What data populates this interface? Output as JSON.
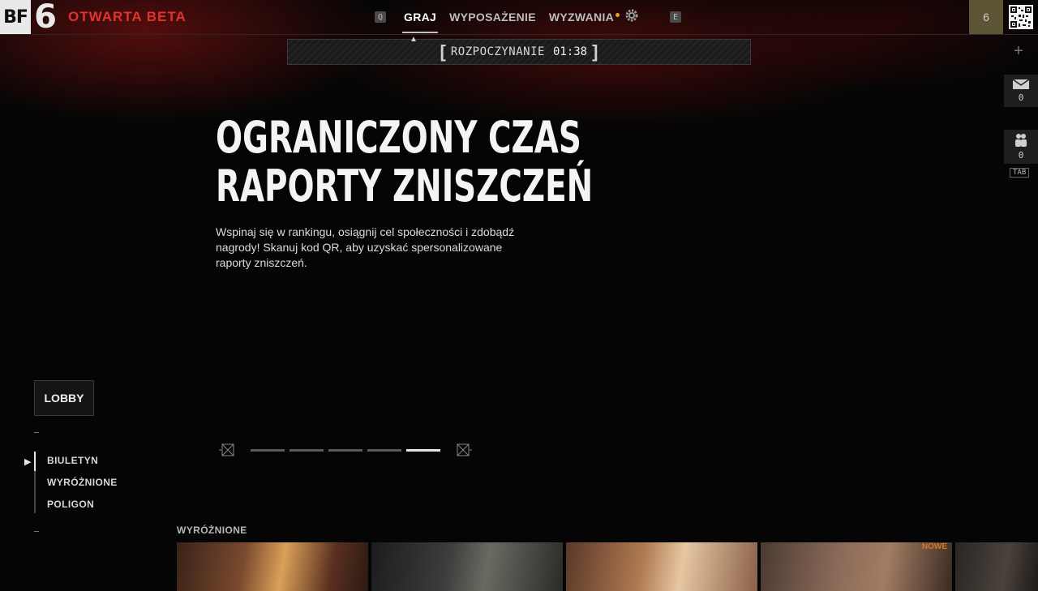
{
  "header": {
    "logo_bf": "BF",
    "logo_six": "6",
    "beta_label": "OTWARTA BETA",
    "profile_level": "6"
  },
  "nav": {
    "left_key": "Q",
    "items": [
      {
        "label": "GRAJ",
        "active": true
      },
      {
        "label": "WYPOSAŻENIE",
        "active": false
      },
      {
        "label": "WYZWANIA",
        "active": false,
        "notification": true
      }
    ],
    "right_key": "E"
  },
  "countdown": {
    "label": "ROZPOCZYNANIE",
    "time": "01:38"
  },
  "rail": {
    "mail_count": "0",
    "squad_count": "0",
    "squad_key": "TAB"
  },
  "hero": {
    "title_line1": "OGRANICZONY CZAS",
    "title_line2": "RAPORTY ZNISZCZEŃ",
    "description": "Wspinaj się w rankingu, osiągnij cel społeczności i zdobądź nagrody! Skanuj kod QR, aby uzyskać spersonalizowane raporty zniszczeń."
  },
  "sidebar": {
    "lobby_label": "LOBBY",
    "items": [
      {
        "label": "BIULETYN",
        "active": true
      },
      {
        "label": "WYRÓŻNIONE",
        "active": false
      },
      {
        "label": "POLIGON",
        "active": false
      }
    ]
  },
  "carousel": {
    "page_count": 5,
    "current_page": 5
  },
  "featured": {
    "section_label": "WYRÓŻNIONE",
    "new_badge": "NOWE"
  },
  "colors": {
    "accent_red": "#e0332e",
    "notification_orange": "#e8a020",
    "new_badge": "#d8782a"
  },
  "icons": [
    "settings-gear-icon",
    "mail-icon",
    "squad-icon",
    "plus-icon",
    "qr-code-icon",
    "prev-arrow-icon",
    "next-arrow-icon"
  ]
}
